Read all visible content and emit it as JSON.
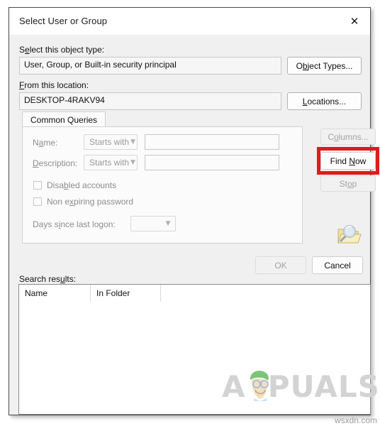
{
  "window": {
    "title": "Select User or Group",
    "close_icon": "close-x-icon"
  },
  "object_type": {
    "label_pre": "S",
    "label_accel": "e",
    "label_post": "lect this object type:",
    "label_full": "Select this object type:",
    "value": "User, Group, or Built-in security principal",
    "button": {
      "pre": "O",
      "accel": "b",
      "post": "ject Types...",
      "full": "Object Types..."
    }
  },
  "location": {
    "label_pre": "",
    "label_accel": "F",
    "label_post": "rom this location:",
    "label_full": "From this location:",
    "value": "DESKTOP-4RAKV94",
    "button": {
      "pre": "",
      "accel": "L",
      "post": "ocations...",
      "full": "Locations..."
    }
  },
  "tabs": [
    {
      "label": "Common Queries",
      "active": true
    }
  ],
  "query": {
    "name": {
      "label_pre": "N",
      "label_accel": "a",
      "label_post": "me:",
      "label_full": "Name:",
      "operator": "Starts with",
      "value": "",
      "disabled": true
    },
    "description": {
      "label_pre": "",
      "label_accel": "D",
      "label_post": "escription:",
      "label_full": "Description:",
      "operator": "Starts with",
      "value": "",
      "disabled": true
    },
    "checkboxes": [
      {
        "label_pre": "Disa",
        "label_accel": "b",
        "label_post": "led accounts",
        "label_full": "Disabled accounts",
        "checked": false,
        "disabled": true
      },
      {
        "label_pre": "Non e",
        "label_accel": "x",
        "label_post": "piring password",
        "label_full": "Non expiring password",
        "checked": false,
        "disabled": true
      }
    ],
    "days_since_logon": {
      "label_pre": "Days s",
      "label_accel": "i",
      "label_post": "nce last logon:",
      "label_full": "Days since last logon:",
      "value": "",
      "disabled": true
    }
  },
  "side_buttons": {
    "columns": {
      "pre": "C",
      "accel": "o",
      "post": "lumns...",
      "full": "Columns...",
      "disabled": true
    },
    "find_now": {
      "pre": "Find ",
      "accel": "N",
      "post": "ow",
      "full": "Find Now",
      "disabled": false,
      "highlighted": true
    },
    "stop": {
      "pre": "St",
      "accel": "o",
      "post": "p",
      "full": "Stop",
      "disabled": true
    },
    "search_icon": "magnifier-folder-icon"
  },
  "dialog_buttons": {
    "ok": {
      "label": "OK",
      "disabled": true
    },
    "cancel": {
      "label": "Cancel",
      "disabled": false
    }
  },
  "search_results": {
    "label_pre": "Search res",
    "label_accel": "u",
    "label_post": "lts:",
    "label_full": "Search results:",
    "columns": [
      "Name",
      "In Folder"
    ],
    "rows": []
  },
  "annotation": {
    "color": "#e01b1b",
    "target": "find-now-button"
  },
  "watermark": {
    "text_a": "A",
    "text_rest": "PUALS",
    "full": "APPUALS",
    "color": "#d3d3d3",
    "mascot_icon": "appuals-mascot-icon"
  },
  "site_credit": "wsxdn.com"
}
